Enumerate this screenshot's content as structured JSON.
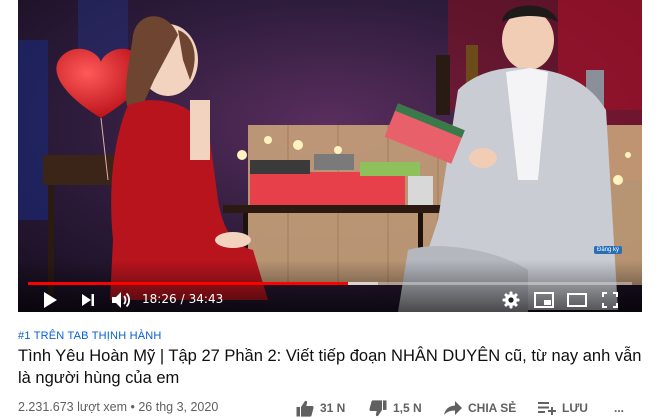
{
  "player": {
    "current_time": "18:26",
    "duration": "34:43",
    "separator": "/",
    "progress_fraction": 0.53,
    "buffered_fraction": 0.58,
    "watermark": "Đăng ký",
    "progress_color": "#ff0000"
  },
  "video": {
    "trending_badge": "#1 TRÊN TAB THỊNH HÀNH",
    "title": "Tình Yêu Hoàn Mỹ | Tập 27 Phần 2: Viết tiếp đoạn NHÂN DUYÊN cũ, từ nay anh vẫn là người hùng của em",
    "views": "2.231.673 lượt xem",
    "date_separator": "•",
    "date": "26 thg 3, 2020"
  },
  "actions": {
    "likes": "31 N",
    "dislikes": "1,5 N",
    "share_label": "CHIA SẺ",
    "save_label": "LƯU",
    "more_label": "..."
  },
  "icons": {
    "play": "play-icon",
    "next": "next-icon",
    "volume": "volume-icon",
    "settings": "gear-icon",
    "miniplayer": "miniplayer-icon",
    "theater": "theater-icon",
    "fullscreen": "fullscreen-icon",
    "like": "thumbs-up-icon",
    "dislike": "thumbs-down-icon",
    "share": "share-arrow-icon",
    "save": "playlist-add-icon",
    "more": "more-icon"
  },
  "colors": {
    "link": "#065fd4",
    "title": "#0f0f0f",
    "meta": "#606060"
  }
}
